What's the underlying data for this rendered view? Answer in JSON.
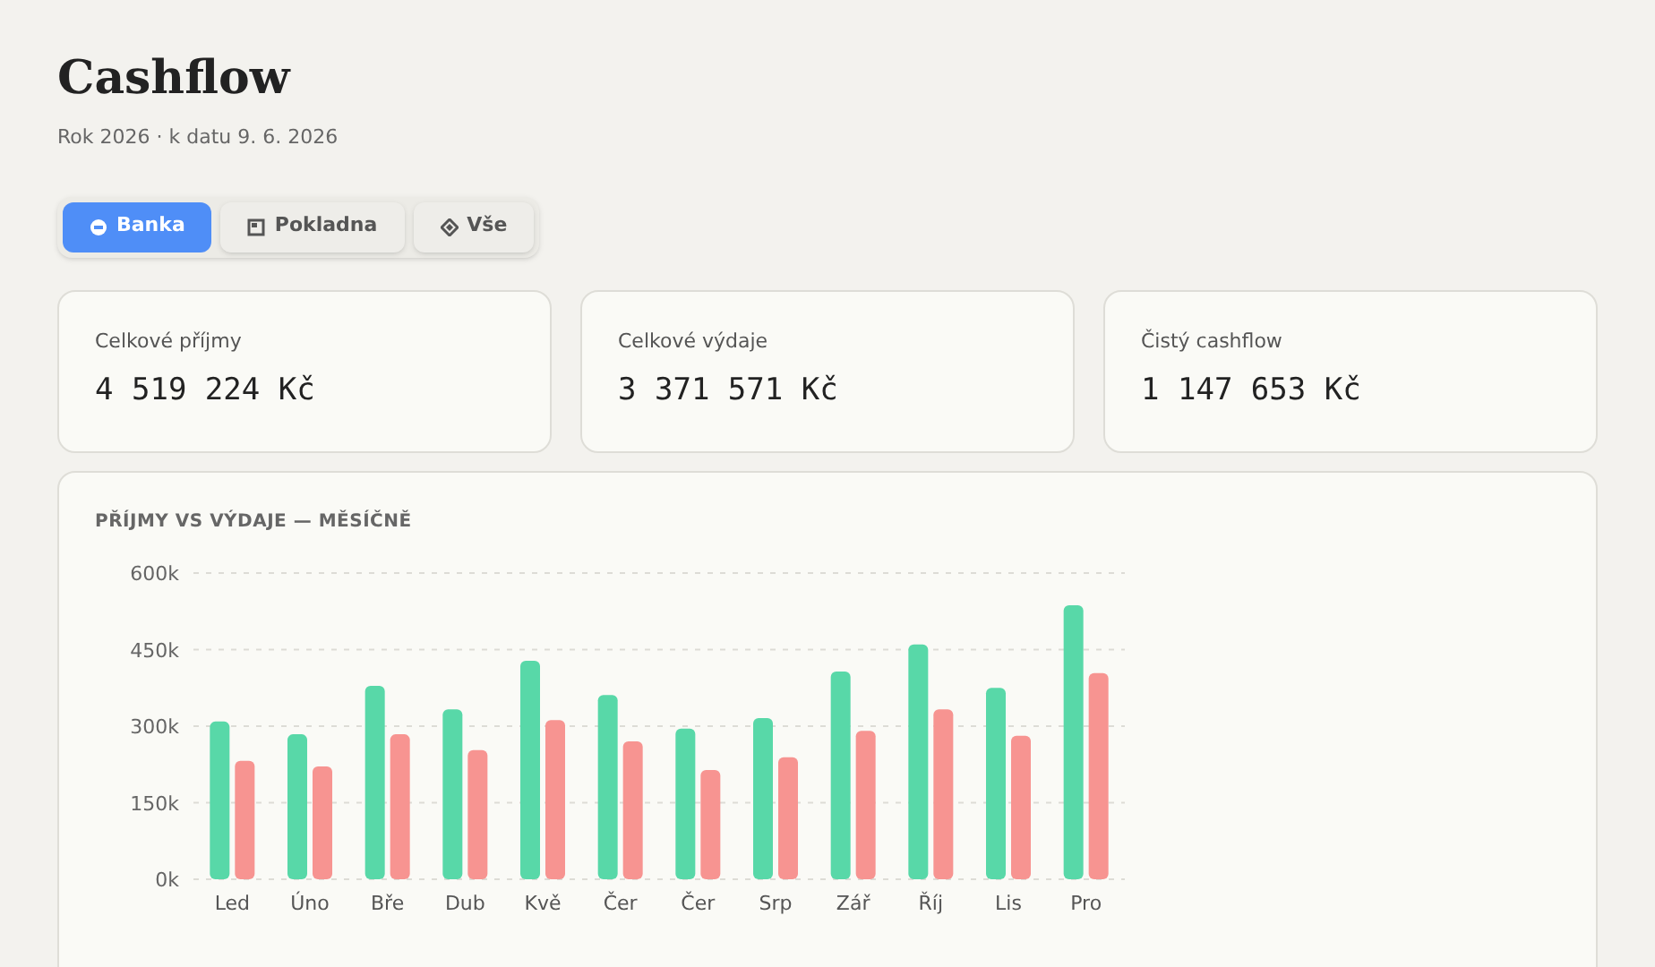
{
  "header": {
    "title": "Cashflow",
    "subtitle": "Rok 2026 · k datu 9. 6. 2026"
  },
  "tabs": [
    {
      "label": "Banka",
      "kind": "bank",
      "selected": true
    },
    {
      "label": "Pokladna",
      "kind": "cash",
      "selected": false
    },
    {
      "label": "Vše",
      "kind": "all",
      "selected": false
    }
  ],
  "stats": [
    {
      "label": "Celkové příjmy",
      "value": "4 519 224 Kč"
    },
    {
      "label": "Celkové výdaje",
      "value": "3 371 571 Kč"
    },
    {
      "label": "Čistý cashflow",
      "value": "1 147 653 Kč"
    }
  ],
  "chart_panel": {
    "title": "PŘÍJMY VS VÝDAJE — MĚSÍČNĚ",
    "chart_data": {
      "type": "bar",
      "categories": [
        "Led",
        "Úno",
        "Bře",
        "Dub",
        "Kvě",
        "Čer",
        "Čer",
        "Srp",
        "Zář",
        "Říj",
        "Lis",
        "Pro"
      ],
      "series": [
        {
          "color": "#58d8a8",
          "values": [
            309,
            284,
            379,
            333,
            428,
            361,
            295,
            316,
            407,
            460,
            375,
            537
          ]
        },
        {
          "color": "#f79491",
          "values": [
            232,
            221,
            284,
            253,
            312,
            270,
            214,
            239,
            291,
            333,
            281,
            404
          ]
        }
      ],
      "grid": true,
      "ylim": [
        0,
        600
      ],
      "yticks": [
        {
          "value": 0,
          "label": "0k"
        },
        {
          "value": 150,
          "label": "150k"
        },
        {
          "value": 300,
          "label": "300k"
        },
        {
          "value": 450,
          "label": "450k"
        },
        {
          "value": 600,
          "label": "600k"
        }
      ]
    }
  }
}
